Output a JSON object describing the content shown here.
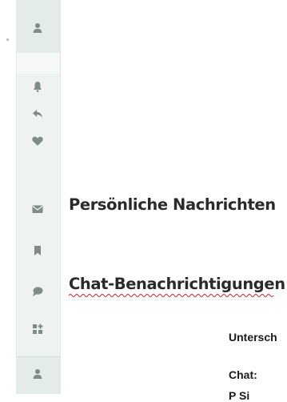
{
  "sidebar": {
    "icons": [
      "user-icon",
      "bell-icon",
      "reply-icon",
      "heart-icon",
      "envelope-icon",
      "bookmark-icon",
      "chat-bubble-icon",
      "apps-icon",
      "user-icon"
    ],
    "icon_color": "#7f8a89"
  },
  "content": {
    "heading_private_messages": "Persönliche Nachrichten",
    "heading_chat_notifications": "Chat-Benachrichtigungen",
    "field_signature_partial": "Untersch",
    "field_chat_label": "Chat:",
    "field_partial_bottom": "P   Si"
  }
}
